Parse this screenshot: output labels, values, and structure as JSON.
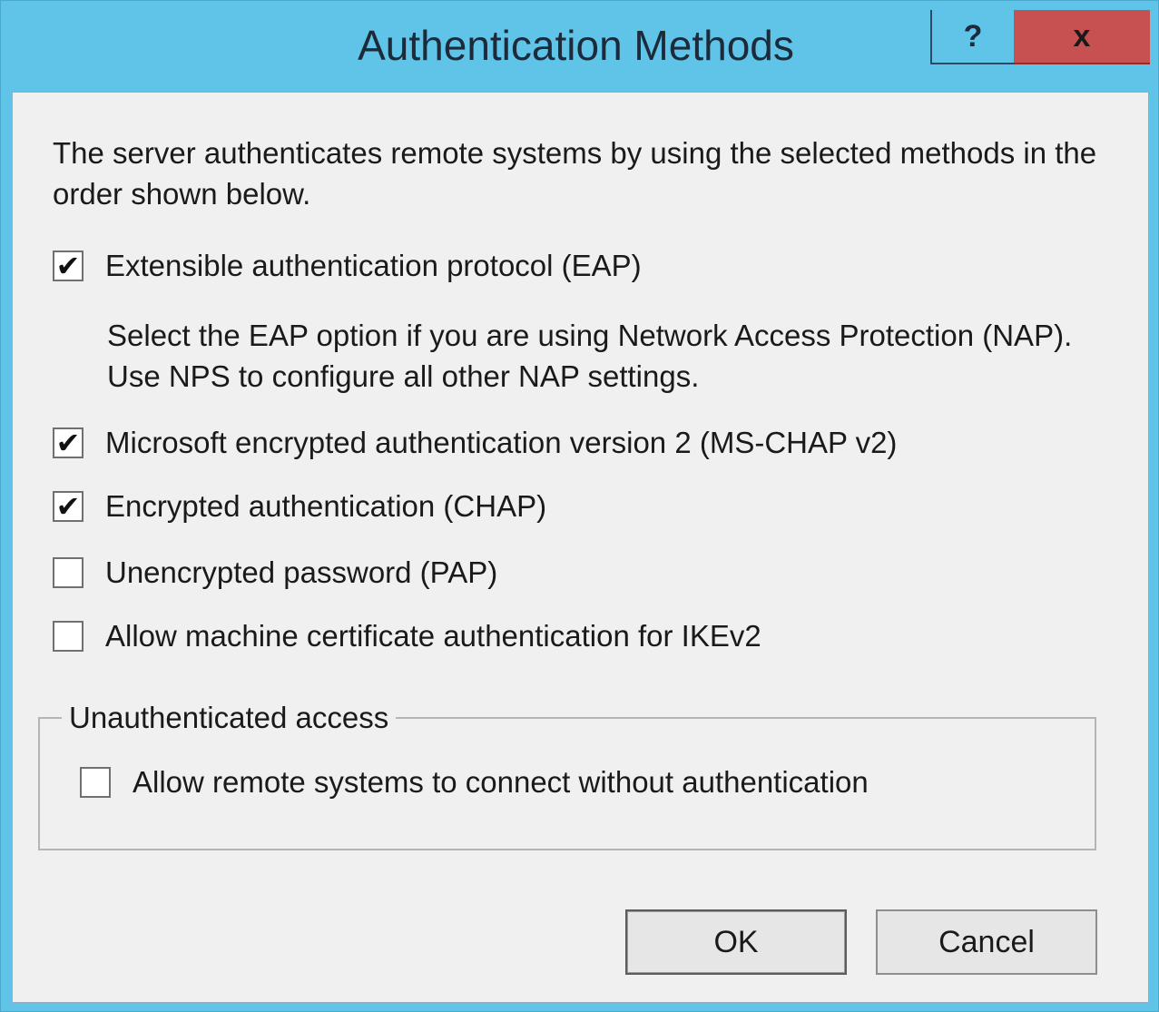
{
  "window": {
    "title": "Authentication Methods",
    "help_label": "?",
    "close_label": "x"
  },
  "intro": "The server authenticates remote systems by using the selected methods in the order shown below.",
  "methods": [
    {
      "label": "Extensible authentication protocol (EAP)",
      "checked": true
    },
    {
      "label": "Microsoft encrypted authentication version 2 (MS-CHAP v2)",
      "checked": true
    },
    {
      "label": "Encrypted authentication (CHAP)",
      "checked": true
    },
    {
      "label": "Unencrypted password (PAP)",
      "checked": false
    },
    {
      "label": "Allow machine certificate authentication for IKEv2",
      "checked": false
    }
  ],
  "eap_note": "Select the EAP option if you are using Network Access Protection (NAP). Use NPS to configure all other NAP settings.",
  "unauthenticated": {
    "title": "Unauthenticated access",
    "option": {
      "label": "Allow remote systems to connect without authentication",
      "checked": false
    }
  },
  "buttons": {
    "ok": "OK",
    "cancel": "Cancel"
  },
  "check_mark": "✔"
}
